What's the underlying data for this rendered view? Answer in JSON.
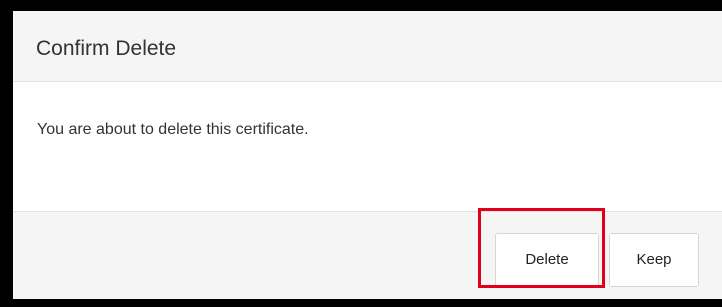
{
  "dialog": {
    "title": "Confirm Delete",
    "message": "You are about to delete this certificate.",
    "buttons": {
      "delete_label": "Delete",
      "keep_label": "Keep"
    }
  },
  "colors": {
    "highlight": "#e0001b",
    "header_background": "#f5f5f5",
    "outer_background": "#000000"
  }
}
